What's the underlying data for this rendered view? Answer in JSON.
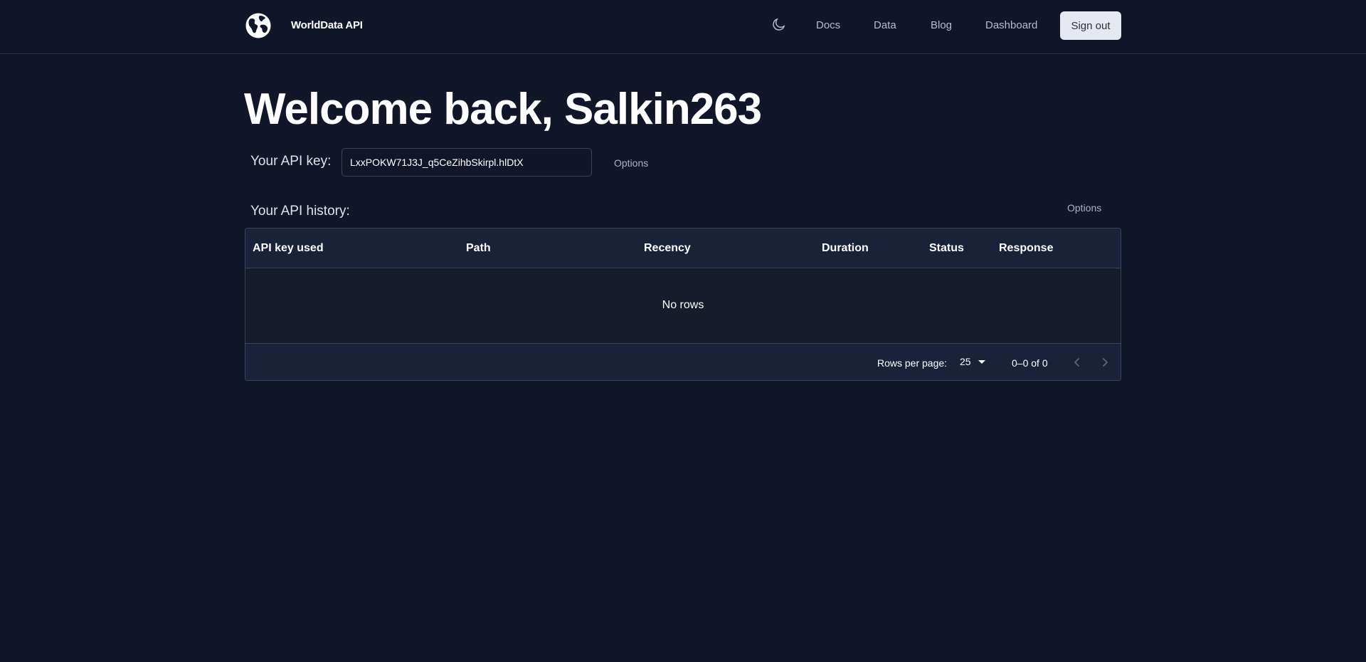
{
  "header": {
    "brand": "WorldData API",
    "logo_icon": "globe-icon",
    "theme_icon": "moon-icon",
    "nav": [
      "Docs",
      "Data",
      "Blog",
      "Dashboard"
    ],
    "signout_label": "Sign out"
  },
  "main": {
    "welcome": "Welcome back, Salkin263",
    "api_key_label": "Your API key:",
    "api_key_value": "LxxPOKW71J3J_q5CeZihbSkirpl.hlDtX",
    "api_key_options": "Options",
    "history_label": "Your API history:",
    "history_options": "Options"
  },
  "table": {
    "columns": [
      "API key used",
      "Path",
      "Recency",
      "Duration",
      "Status",
      "Response"
    ],
    "empty_text": "No rows",
    "rows_per_page_label": "Rows per page:",
    "rows_per_page": "25",
    "range": "0–0 of 0"
  },
  "colors": {
    "background": "#111729",
    "header_row": "#1a2239",
    "border": "#3b4256",
    "button": "#e5e8f1"
  }
}
